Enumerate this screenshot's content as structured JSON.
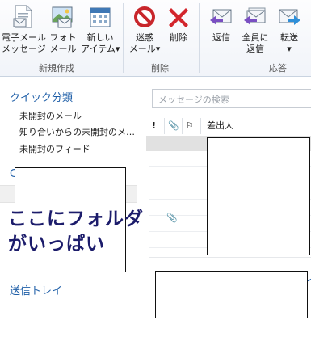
{
  "ribbon": {
    "groups": [
      {
        "label": "新規作成"
      },
      {
        "label": "削除"
      },
      {
        "label": "応答"
      }
    ],
    "buttons": {
      "new_email": {
        "line1": "電子メール",
        "line2": "メッセージ"
      },
      "photo_mail": {
        "line1": "フォト",
        "line2": "メール"
      },
      "new_item": {
        "line1": "新しい",
        "line2": "アイテム▾"
      },
      "junk": {
        "line1": "迷惑",
        "line2": "メール▾"
      },
      "delete": {
        "line1": "削除"
      },
      "reply": {
        "line1": "返信"
      },
      "reply_all": {
        "line1": "全員に",
        "line2": "返信"
      },
      "forward": {
        "line1": "転送",
        "line2": "▾"
      }
    }
  },
  "nav": {
    "quick_views_title": "クイック分類",
    "quick_views": [
      "未開封のメール",
      "知り合いからの未開封のメ…",
      "未開封のフィード"
    ],
    "partial_header": "C",
    "outbox": "送信トレイ"
  },
  "overlay_note": "ここにフォルダがいっぱい",
  "search": {
    "placeholder": "メッセージの検索"
  },
  "mail_list": {
    "columns": {
      "importance": "!",
      "attachment": "📎",
      "flag": "⚐",
      "from": "差出人"
    },
    "partial_text": "イ"
  },
  "colors": {
    "accent": "#1f5fa8",
    "selected_row": "#e1e1e1"
  }
}
